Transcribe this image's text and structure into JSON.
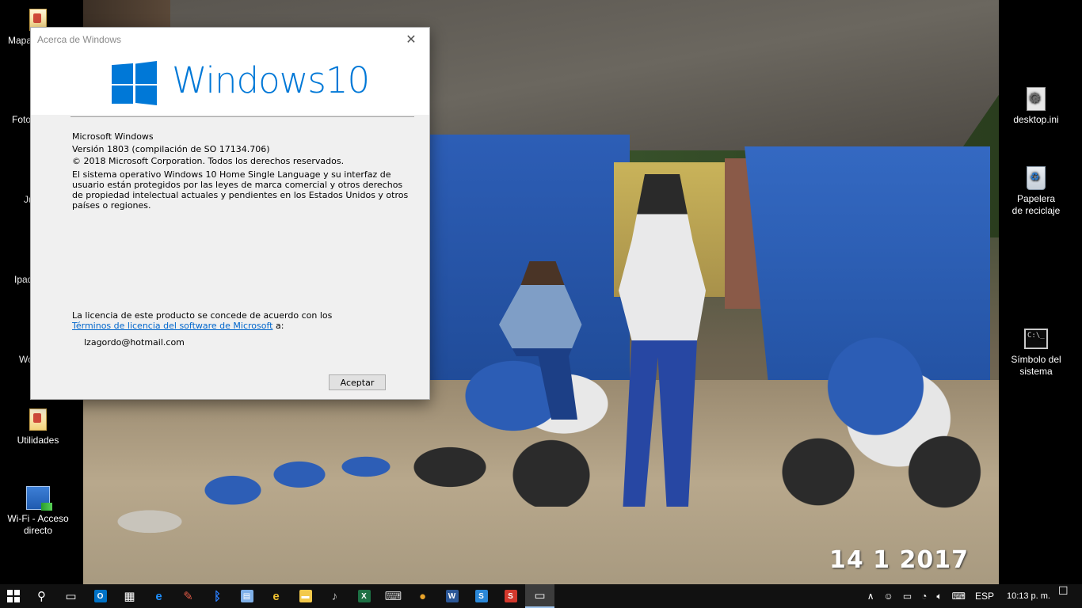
{
  "window": {
    "title": "Acerca de Windows",
    "close_glyph": "✕",
    "brand_text": "Windows10",
    "product": "Microsoft Windows",
    "version": "Versión 1803 (compilación de SO 17134.706)",
    "copyright": "© 2018 Microsoft Corporation. Todos los derechos reservados.",
    "legal_text": "El sistema operativo Windows 10 Home Single Language y su interfaz de usuario están protegidos por las leyes de marca comercial y otros derechos de propiedad intelectual actuales y pendientes en los Estados Unidos y otros países o regiones.",
    "license_intro": "La licencia de este producto se concede de acuerdo con los",
    "license_link": "Términos de licencia del software de Microsoft",
    "license_suffix": " a:",
    "licensed_user": "lzagordo@hotmail.com",
    "ok_button": "Aceptar",
    "accent_color": "#0078d7"
  },
  "desktop": {
    "left_icons": [
      {
        "label": "Mapa",
        "icon": "folder-icon"
      },
      {
        "label": "Foto",
        "icon": "folder-icon"
      },
      {
        "label": "Ju",
        "icon": "folder-icon"
      },
      {
        "label": "Ipad",
        "icon": "folder-icon"
      },
      {
        "label": "Wo",
        "icon": "folder-icon"
      },
      {
        "label": "Utilidades",
        "icon": "folder-icon"
      },
      {
        "label": "Wi-Fi - Acceso directo",
        "icon": "wifi-shortcut-icon"
      }
    ],
    "right_icons": [
      {
        "label": "desktop.ini",
        "icon": "settings-file-icon"
      },
      {
        "label": "Papelera de reciclaje",
        "icon": "recycle-bin-icon"
      },
      {
        "label": "Símbolo del sistema",
        "icon": "command-prompt-icon"
      }
    ],
    "wallpaper_date": "14 1 2017"
  },
  "taskbar": {
    "apps": [
      {
        "name": "search-icon",
        "glyph": "⚲",
        "color": "#ffffff"
      },
      {
        "name": "task-view-icon",
        "glyph": "▭",
        "color": "#ffffff"
      },
      {
        "name": "outlook-icon",
        "glyph": "O",
        "color": "#0072c6"
      },
      {
        "name": "calculator-icon",
        "glyph": "▦",
        "color": "#ffffff"
      },
      {
        "name": "edge-icon",
        "glyph": "e",
        "color": "#1e90ff"
      },
      {
        "name": "paint-icon",
        "glyph": "✎",
        "color": "#e05a47"
      },
      {
        "name": "bluetooth-icon",
        "glyph": "ᛒ",
        "color": "#2a7fff"
      },
      {
        "name": "control-panel-icon",
        "glyph": "▤",
        "color": "#7fb0e8"
      },
      {
        "name": "internet-explorer-icon",
        "glyph": "e",
        "color": "#f2c230"
      },
      {
        "name": "file-explorer-icon",
        "glyph": "▬",
        "color": "#f3c94b"
      },
      {
        "name": "media-icon",
        "glyph": "♪",
        "color": "#c0c0c0"
      },
      {
        "name": "excel-icon",
        "glyph": "X",
        "color": "#1d7044"
      },
      {
        "name": "keyboard-app-icon",
        "glyph": "⌨",
        "color": "#cccccc"
      },
      {
        "name": "chrome-icon",
        "glyph": "●",
        "color": "#e8a32a"
      },
      {
        "name": "word-icon",
        "glyph": "W",
        "color": "#2b5797"
      },
      {
        "name": "sway-icon",
        "glyph": "S",
        "color": "#2b88d8"
      },
      {
        "name": "wps-icon",
        "glyph": "S",
        "color": "#d3382c"
      },
      {
        "name": "about-windows-icon",
        "glyph": "▭",
        "color": "#ffffff"
      }
    ],
    "tray": {
      "chevron": "∧",
      "language": "ESP",
      "time": "10:13 p. m.",
      "notifications_glyph": "☐"
    }
  }
}
